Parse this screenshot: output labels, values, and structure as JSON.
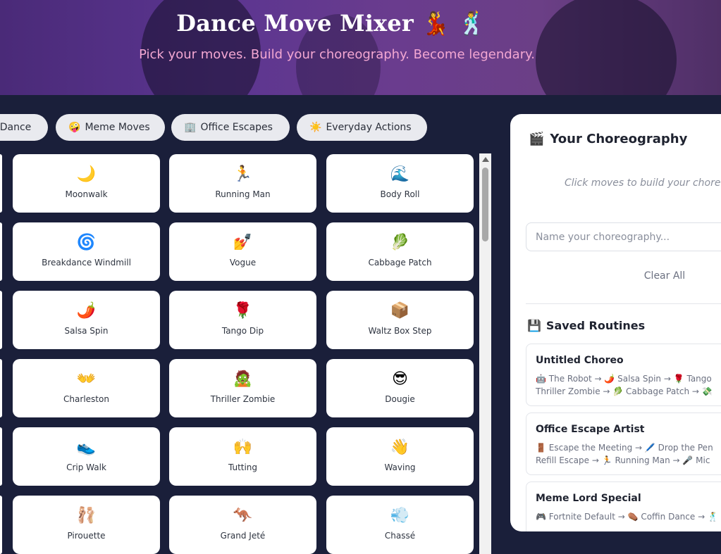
{
  "header": {
    "title": "Dance Move Mixer 💃 🕺",
    "subtitle": "Pick your moves. Build your choreography. Become legendary."
  },
  "tabs": [
    {
      "icon": "",
      "label": "s Dance"
    },
    {
      "icon": "🤪",
      "label": "Meme Moves"
    },
    {
      "icon": "🏢",
      "label": "Office Escapes"
    },
    {
      "icon": "☀️",
      "label": "Everyday Actions"
    }
  ],
  "moves": [
    {
      "emoji": "🌙",
      "label": "Moonwalk"
    },
    {
      "emoji": "🏃",
      "label": "Running Man"
    },
    {
      "emoji": "🌊",
      "label": "Body Roll"
    },
    {
      "emoji": "🌀",
      "label": "Breakdance Windmill"
    },
    {
      "emoji": "💅",
      "label": "Vogue"
    },
    {
      "emoji": "🥬",
      "label": "Cabbage Patch"
    },
    {
      "emoji": "🌶️",
      "label": "Salsa Spin"
    },
    {
      "emoji": "🌹",
      "label": "Tango Dip"
    },
    {
      "emoji": "📦",
      "label": "Waltz Box Step"
    },
    {
      "emoji": "👐",
      "label": "Charleston"
    },
    {
      "emoji": "🧟",
      "label": "Thriller Zombie"
    },
    {
      "emoji": "😎",
      "label": "Dougie"
    },
    {
      "emoji": "👟",
      "label": "Crip Walk"
    },
    {
      "emoji": "🙌",
      "label": "Tutting"
    },
    {
      "emoji": "👋",
      "label": "Waving"
    },
    {
      "emoji": "🩰",
      "label": "Pirouette"
    },
    {
      "emoji": "🦘",
      "label": "Grand Jeté"
    },
    {
      "emoji": "💨",
      "label": "Chassé"
    }
  ],
  "panel": {
    "title_icon": "🎬",
    "title": "Your Choreography",
    "empty_hint": "Click moves to build your chore",
    "name_placeholder": "Name your choreography...",
    "clear_label": "Clear All",
    "saved_icon": "💾",
    "saved_title": "Saved Routines"
  },
  "routines": [
    {
      "title": "Untitled Choreo",
      "line1": "🤖 The Robot → 🌶️ Salsa Spin → 🌹 Tango",
      "line2": "Thriller Zombie → 🥬 Cabbage Patch → 💸"
    },
    {
      "title": "Office Escape Artist",
      "line1": "🚪 Escape the Meeting → 🖊️ Drop the Pen",
      "line2": "Refill Escape → 🏃 Running Man → 🎤 Mic"
    },
    {
      "title": "Meme Lord Special",
      "line1": "🎮 Fortnite Default → ⚰️ Coffin Dance → 🕺",
      "line2": ""
    }
  ],
  "colors": {
    "background": "#1a1f3a",
    "hero_purple": "#5b3590",
    "subtitle_pink": "#f3a7d2",
    "card_bg": "#ffffff",
    "tab_bg": "#e9eaef"
  }
}
